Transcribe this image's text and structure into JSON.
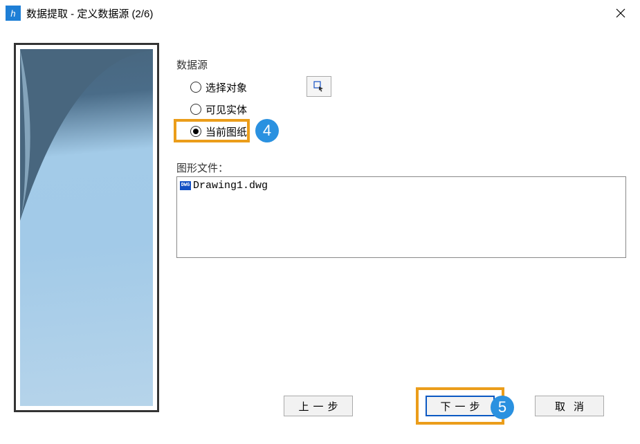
{
  "window": {
    "title": "数据提取 - 定义数据源 (2/6)"
  },
  "dataSource": {
    "groupLabel": "数据源",
    "options": {
      "selectObjects": "选择对象",
      "visibleEntities": "可见实体",
      "currentDrawing": "当前图纸"
    }
  },
  "files": {
    "label": "图形文件：",
    "items": [
      {
        "name": "Drawing1.dwg"
      }
    ]
  },
  "buttons": {
    "prev": "上一步",
    "next": "下一步",
    "cancel": "取消"
  },
  "callouts": {
    "c4": "4",
    "c5": "5"
  }
}
